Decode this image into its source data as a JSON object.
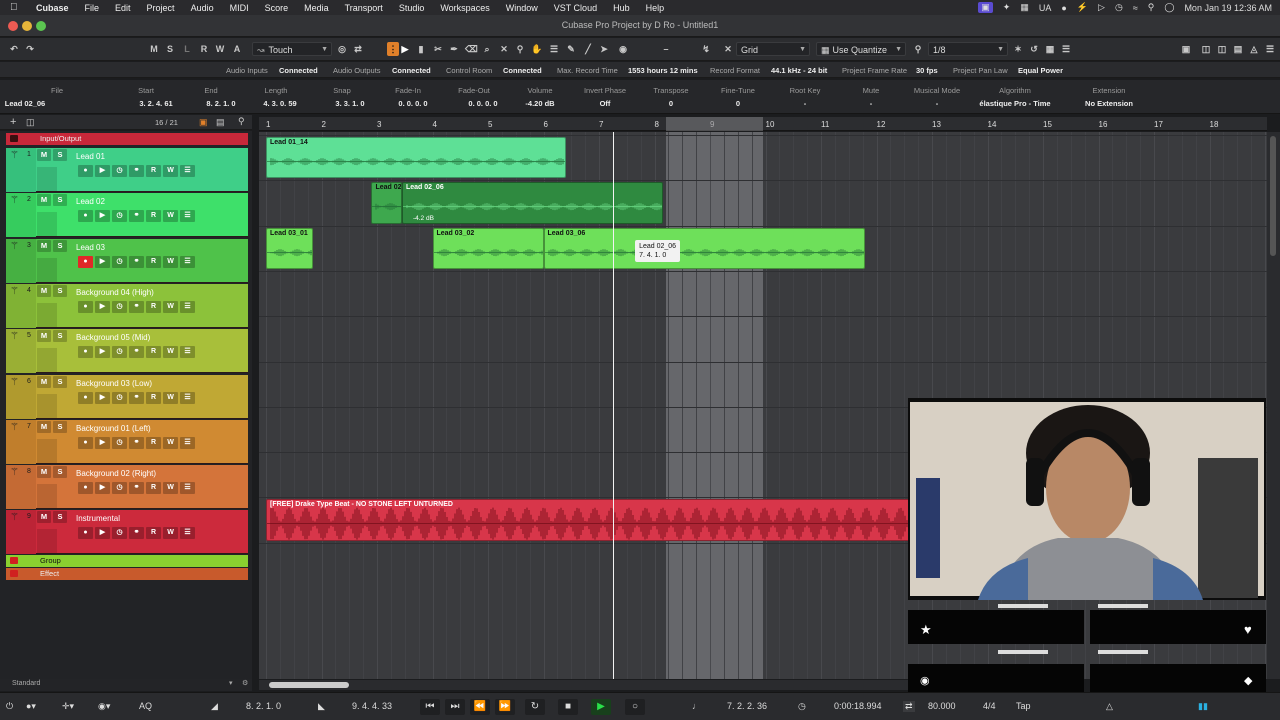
{
  "menubar": {
    "app": "Cubase",
    "items": [
      "File",
      "Edit",
      "Project",
      "Audio",
      "MIDI",
      "Score",
      "Media",
      "Transport",
      "Studio",
      "Workspaces",
      "Window",
      "VST Cloud",
      "Hub",
      "Help"
    ],
    "input_lang": "UA",
    "clock": "Mon Jan 19  12:36 AM"
  },
  "window": {
    "title": "Cubase Pro Project by D Ro - Untitled1"
  },
  "toolbar": {
    "buttons": [
      "M",
      "S",
      "L",
      "R",
      "W",
      "A"
    ],
    "automation_mode": "Touch",
    "grid_type": "Grid",
    "quantize_mode": "Use Quantize",
    "quantize_value": "1/8"
  },
  "status": [
    {
      "label": "Audio Inputs",
      "value": "Connected"
    },
    {
      "label": "Audio Outputs",
      "value": "Connected"
    },
    {
      "label": "Control Room",
      "value": "Connected"
    },
    {
      "label": "Max. Record Time",
      "value": "1553 hours 12 mins"
    },
    {
      "label": "Record Format",
      "value": "44.1 kHz - 24 bit"
    },
    {
      "label": "Project Frame Rate",
      "value": "30 fps"
    },
    {
      "label": "Project Pan Law",
      "value": "Equal Power"
    }
  ],
  "infoline": [
    {
      "label": "File",
      "value": "Lead 02_06"
    },
    {
      "label": "Start",
      "value": "3. 2. 4. 61"
    },
    {
      "label": "End",
      "value": "8. 2. 1. 0"
    },
    {
      "label": "Length",
      "value": "4. 3. 0. 59"
    },
    {
      "label": "Snap",
      "value": "3. 3. 1. 0"
    },
    {
      "label": "Fade-In",
      "value": "0. 0. 0. 0"
    },
    {
      "label": "Fade-Out",
      "value": "0. 0. 0. 0"
    },
    {
      "label": "Volume",
      "value": "-4.20   dB"
    },
    {
      "label": "Invert Phase",
      "value": "Off"
    },
    {
      "label": "Transpose",
      "value": "0"
    },
    {
      "label": "Fine-Tune",
      "value": "0"
    },
    {
      "label": "Root Key",
      "value": "-"
    },
    {
      "label": "Mute",
      "value": "-"
    },
    {
      "label": "Musical Mode",
      "value": "-"
    },
    {
      "label": "Algorithm",
      "value": "élastique Pro - Time"
    },
    {
      "label": "Extension",
      "value": "No Extension"
    }
  ],
  "tracklist": {
    "counter": "16 / 21",
    "folders": {
      "top": "Input/Output",
      "group": "Group",
      "effect": "Effect"
    },
    "footer": "Standard",
    "tracks": [
      {
        "num": "1",
        "name": "Lead 01",
        "color": "#3fcf88",
        "strip": "#36c07c",
        "record": false
      },
      {
        "num": "2",
        "name": "Lead 02",
        "color": "#3ee06a",
        "strip": "#36cc5e",
        "record": false
      },
      {
        "num": "3",
        "name": "Lead 03",
        "color": "#4fc24a",
        "strip": "#46b042",
        "record": true
      },
      {
        "num": "4",
        "name": "Background 04 (High)",
        "color": "#8cc23a",
        "strip": "#80b234",
        "record": false
      },
      {
        "num": "5",
        "name": "Background 05 (Mid)",
        "color": "#a8bf3a",
        "strip": "#9aaf34",
        "record": false
      },
      {
        "num": "6",
        "name": "Background 03 (Low)",
        "color": "#c0a834",
        "strip": "#b09a2e",
        "record": false
      },
      {
        "num": "7",
        "name": "Background 01 (Left)",
        "color": "#d08a32",
        "strip": "#c07e2c",
        "record": false
      },
      {
        "num": "8",
        "name": "Background 02 (Right)",
        "color": "#d4743a",
        "strip": "#c46a34",
        "record": false
      },
      {
        "num": "9",
        "name": "Instrumental",
        "color": "#cc2a3c",
        "strip": "#bc2436",
        "record": false
      }
    ]
  },
  "ruler": {
    "bars": [
      "1",
      "2",
      "3",
      "4",
      "5",
      "6",
      "7",
      "8",
      "9",
      "10",
      "11",
      "12",
      "13",
      "14",
      "15",
      "16",
      "17",
      "18"
    ]
  },
  "events": [
    {
      "track": 0,
      "label": "Lead 01_14",
      "start": 1.0,
      "end": 6.4,
      "color": "#5ee096"
    },
    {
      "track": 1,
      "label": "Lead 02",
      "start": 2.9,
      "end": 3.45,
      "color": "#3ea84e"
    },
    {
      "track": 1,
      "label": "Lead 02_06",
      "start": 3.45,
      "end": 8.15,
      "color": "#2f8a40",
      "volume": "-4.2 dB"
    },
    {
      "track": 2,
      "label": "Lead 03_01",
      "start": 1.0,
      "end": 1.85,
      "color": "#6ee05a"
    },
    {
      "track": 2,
      "label": "Lead 03_02",
      "start": 4.0,
      "end": 6.0,
      "color": "#6ee05a"
    },
    {
      "track": 2,
      "label": "Lead 03_06",
      "start": 6.0,
      "end": 11.8,
      "color": "#6ee05a"
    },
    {
      "track": 8,
      "label": "[FREE] Drake Type Beat - NO STONE LEFT UNTURNED",
      "start": 1.0,
      "end": 18.9,
      "color": "#d8364a"
    }
  ],
  "drag_tooltip": {
    "name": "Lead 02_06",
    "position": "7. 4. 1. 0"
  },
  "cycle": {
    "start": 8.2,
    "end": 9.95
  },
  "playhead": 7.25,
  "transport": {
    "left_locator": "8. 2. 1. 0",
    "right_locator": "9. 4. 4. 33",
    "position_bars": "7. 2. 2. 36",
    "position_time": "0:00:18.994",
    "tempo": "80.000",
    "signature": "4/4",
    "tap_label": "Tap",
    "aq_label": "AQ"
  }
}
